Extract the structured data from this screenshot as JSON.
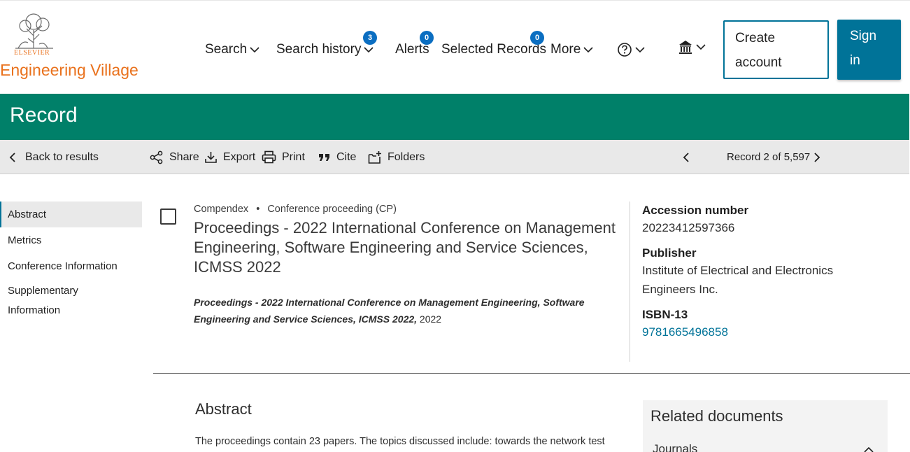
{
  "brand": {
    "publisher": "ELSEVIER",
    "product": "Engineering Village",
    "color": "#e9711c"
  },
  "nav": {
    "search": "Search",
    "search_history": "Search history",
    "search_history_count": "3",
    "alerts": "Alerts",
    "alerts_count": "0",
    "selected_records": "Selected Records",
    "selected_records_count": "0",
    "more": "More",
    "help_icon": "help-circle-icon",
    "institution_icon": "institution-icon"
  },
  "auth": {
    "create_account_line1": "Create",
    "create_account_line2": "account",
    "sign_in_line1": "Sign",
    "sign_in_line2": "in",
    "accent": "#007398"
  },
  "banner": {
    "title": "Record",
    "color": "#008069"
  },
  "toolbar": {
    "back": "Back to results",
    "share": "Share",
    "export": "Export",
    "print": "Print",
    "cite": "Cite",
    "folders": "Folders",
    "record_position": "Record 2 of 5,597"
  },
  "sidenav": {
    "items": [
      "Abstract",
      "Metrics",
      "Conference Information",
      "Supplementary",
      "Information"
    ]
  },
  "record": {
    "database": "Compendex",
    "doc_type": "Conference proceeding (CP)",
    "title": "Proceedings - 2022 International Conference on Management Engineering, Software Engineering and Service Sciences, ICMSS 2022",
    "source_title": "Proceedings - 2022 International Conference on Management Engineering, Software Engineering and Service Sciences, ICMSS 2022,",
    "source_year": "2022",
    "accession_label": "Accession number",
    "accession_value": "20223412597366",
    "publisher_label": "Publisher",
    "publisher_line1": "Institute of Electrical and Electronics",
    "publisher_line2": "Engineers Inc.",
    "isbn_label": "ISBN-13",
    "isbn_value": "9781665496858"
  },
  "abstract": {
    "heading": "Abstract",
    "text": "The proceedings contain 23 papers. The topics discussed include: towards the network test"
  },
  "related": {
    "heading": "Related documents",
    "journals": "Journals"
  }
}
